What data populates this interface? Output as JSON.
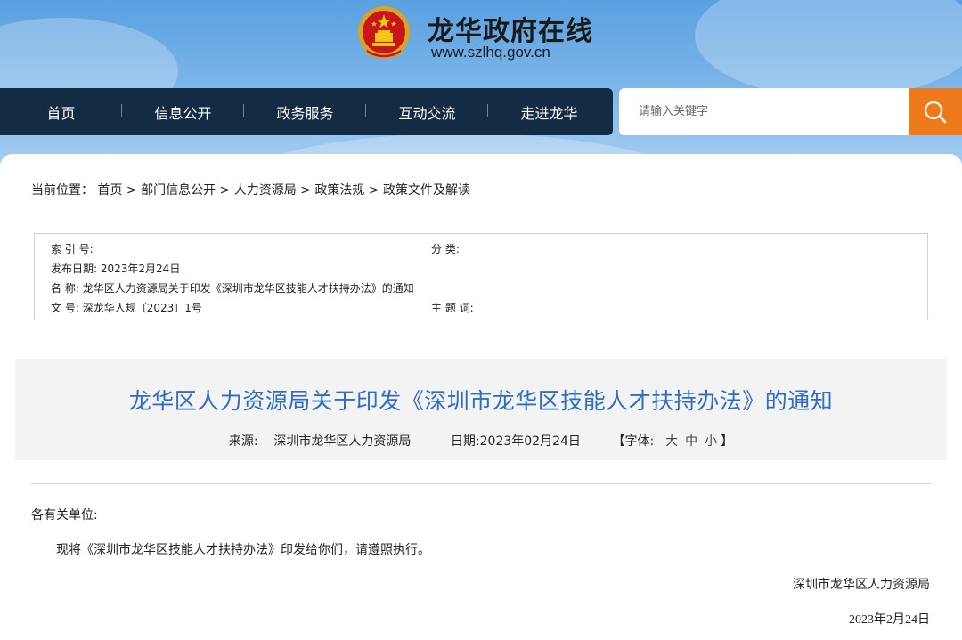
{
  "header": {
    "site_title": "龙华政府在线",
    "site_url": "www.szlhq.gov.cn"
  },
  "nav": {
    "items": [
      {
        "label": "首页"
      },
      {
        "label": "信息公开"
      },
      {
        "label": "政务服务"
      },
      {
        "label": "互动交流"
      },
      {
        "label": "走进龙华"
      }
    ]
  },
  "search": {
    "placeholder": "请输入关键字",
    "icon": "search-icon"
  },
  "breadcrumb": {
    "prefix": "当前位置：",
    "items": [
      "首页",
      "部门信息公开",
      "人力资源局",
      "政策法规",
      "政策文件及解读"
    ],
    "separator": ">"
  },
  "meta": {
    "index_label": "索 引 号:",
    "index_value": "",
    "category_label": "分 类:",
    "category_value": "",
    "publish_date_label": "发布日期:",
    "publish_date_value": "2023年2月24日",
    "name_label": "名 称:",
    "name_value": "龙华区人力资源局关于印发《深圳市龙华区技能人才扶持办法》的通知",
    "doc_no_label": "文 号:",
    "doc_no_value": "深龙华人规〔2023〕1号",
    "subject_label": "主 题 词:",
    "subject_value": ""
  },
  "article": {
    "title": "龙华区人力资源局关于印发《深圳市龙华区技能人才扶持办法》的通知",
    "source_label": "来源:",
    "source_value": "深圳市龙华区人力资源局",
    "date_label": "日期:",
    "date_value": "2023年02月24日",
    "font_label": "【字体:",
    "font_large": "大",
    "font_medium": "中",
    "font_small": "小",
    "font_close": "】",
    "salutation": "各有关单位:",
    "body": "现将《深圳市龙华区技能人才扶持办法》印发给你们，请遵照执行。",
    "signoff": "深圳市龙华区人力资源局",
    "signoff_date": "2023年2月24日"
  },
  "colors": {
    "nav_bg": "#132c44",
    "search_button": "#ee7a1b",
    "title_color": "#2f6cc4"
  }
}
